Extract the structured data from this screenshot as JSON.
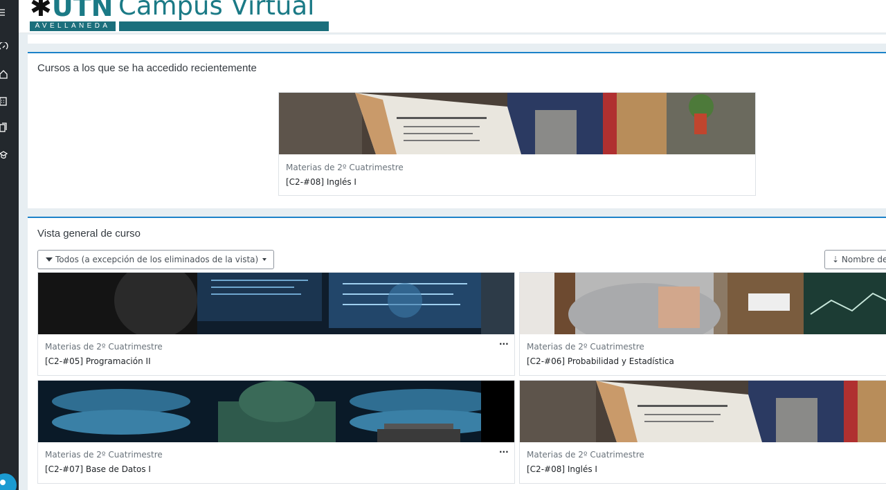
{
  "app": {
    "logo_utn": "UTN",
    "logo_subtitle": "AVELLANEDA",
    "logo_title": "Campus Virtual"
  },
  "rail": {
    "items": [
      {
        "icon": "menu-icon"
      },
      {
        "icon": "dashboard-icon"
      },
      {
        "icon": "home-icon"
      },
      {
        "icon": "calendar-icon"
      },
      {
        "icon": "files-icon"
      },
      {
        "icon": "graduation-cap-icon"
      }
    ]
  },
  "recent": {
    "title": "Cursos a los que se ha accedido recientemente",
    "courses": [
      {
        "category": "Materias de 2º Cuatrimestre",
        "name": "[C2-#08] Inglés I",
        "image": "student-reading-book"
      }
    ]
  },
  "overview": {
    "title": "Vista general de curso",
    "filter_label": "Todos (a excepción de los eliminados de la vista)",
    "sort_label": "Nombre de",
    "menu_label": "···",
    "courses": [
      {
        "category": "Materias de 2º Cuatrimestre",
        "name": "[C2-#05] Programación II",
        "image": "programmer-monitors"
      },
      {
        "category": "Materias de 2º Cuatrimestre",
        "name": "[C2-#06] Probabilidad y Estadística",
        "image": "student-thinking-charts"
      },
      {
        "category": "Materias de 2º Cuatrimestre",
        "name": "[C2-#07] Base de Datos I",
        "image": "person-data-servers"
      },
      {
        "category": "Materias de 2º Cuatrimestre",
        "name": "[C2-#08] Inglés I",
        "image": "student-reading-book"
      }
    ]
  },
  "colors": {
    "accent": "#1b82c9",
    "brand": "#1b7a86",
    "rail": "#23282d"
  }
}
